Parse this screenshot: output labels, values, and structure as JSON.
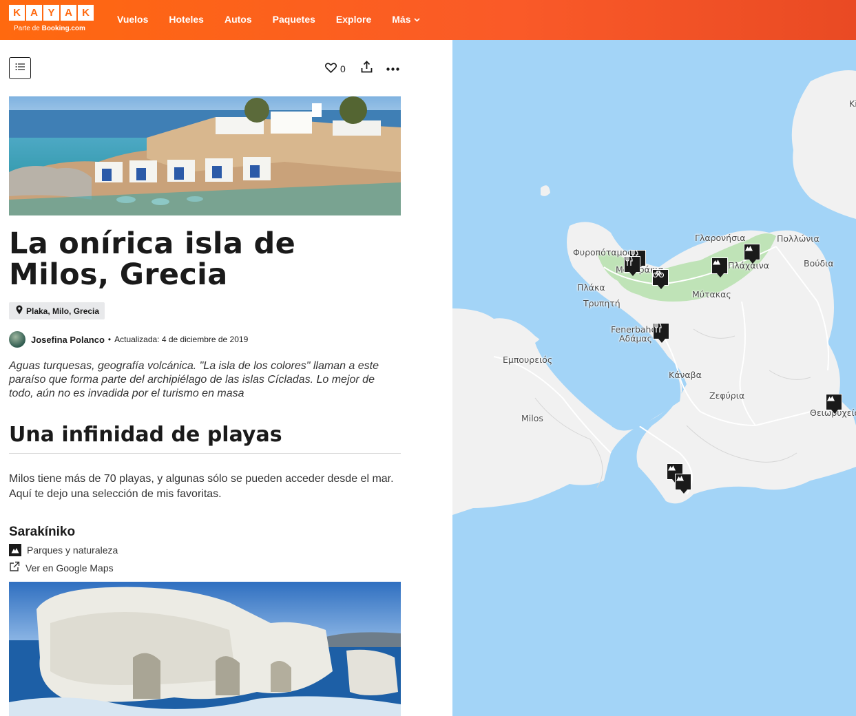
{
  "header": {
    "logo_letters": [
      "K",
      "A",
      "Y",
      "A",
      "K"
    ],
    "logo_sub_prefix": "Parte de",
    "logo_sub_brand": "Booking.com",
    "nav": [
      "Vuelos",
      "Hoteles",
      "Autos",
      "Paquetes",
      "Explore",
      "Más"
    ]
  },
  "toolbar": {
    "like_count": "0"
  },
  "article": {
    "title": "La onírica isla de Milos, Grecia",
    "location_tag": "Plaka, Milo, Grecia",
    "author_name": "Josefina Polanco",
    "updated": "Actualizada: 4 de diciembre de 2019",
    "intro": "Aguas turquesas, geografía volcánica. \"La isla de los colores\" llaman a este paraíso que forma parte del archipiélago de las islas Cícladas. Lo mejor de todo, aún no es invadida por el turismo en masa",
    "section_title": "Una infinidad de playas",
    "section_text": "Milos tiene más de 70 playas, y algunas sólo se pueden acceder desde el mar. Aquí te dejo una selección de mis favoritas.",
    "place": {
      "name": "Sarakíniko",
      "category": "Parques y naturaleza",
      "maps_link": "Ver en Google Maps"
    }
  },
  "map": {
    "labels": [
      "Γλαρονήσια",
      "Πολλώνια",
      "Φυροπόταμος",
      "Μανδράκια",
      "Βούδια",
      "Πλάκα",
      "Τρυπητή",
      "Μύτακας",
      "Fenerbahc",
      "Αδάμας",
      "Εμπουρειός",
      "Κάναβα",
      "Ζεφύρια",
      "Milos",
      "Θειωρυχεία",
      "Ki",
      "Πλάχαινα"
    ],
    "pins": [
      {
        "icon": "restaurant-icon"
      },
      {
        "icon": "restaurant-icon"
      },
      {
        "icon": "bicycle-icon"
      },
      {
        "icon": "restaurant-icon"
      },
      {
        "icon": "mountain-icon"
      },
      {
        "icon": "mountain-icon"
      },
      {
        "icon": "mountain-icon"
      },
      {
        "icon": "mountain-icon"
      },
      {
        "icon": "mountain-icon"
      }
    ],
    "colors": {
      "sea": "#a3d4f7",
      "land": "#f1f1f1",
      "park": "#bfe3b7"
    }
  }
}
